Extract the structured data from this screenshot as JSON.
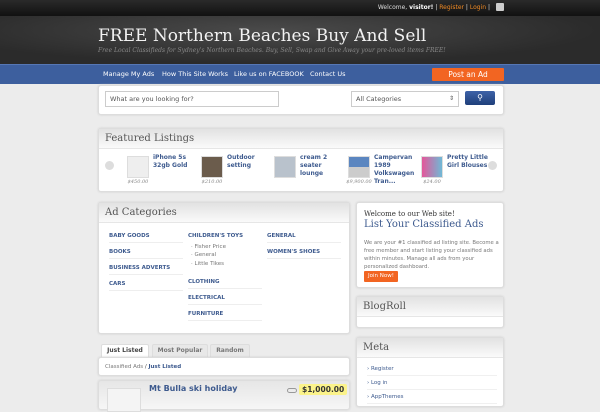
{
  "topbar": {
    "welcome": "Welcome,",
    "user": "visitor!",
    "register": "Register",
    "login": "Login",
    "sep": "|"
  },
  "header": {
    "title": "FREE Northern Beaches Buy And Sell",
    "tagline": "Free Local Classifieds for Sydney's Northern Beaches. Buy, Sell, Swap and Give Away your pre-loved items FREE!"
  },
  "nav": {
    "items": [
      "Manage My Ads",
      "How This Site Works",
      "Like us on FACEBOOK",
      "Contact Us"
    ],
    "post_ad": "Post an Ad"
  },
  "search": {
    "placeholder": "What are you looking for?",
    "category": "All Categories"
  },
  "featured": {
    "title": "Featured Listings",
    "items": [
      {
        "title": "iPhone 5s 32gb Gold",
        "price": "$450.00"
      },
      {
        "title": "Outdoor setting",
        "price": "$210.00"
      },
      {
        "title": "cream 2 seater lounge",
        "price": ""
      },
      {
        "title": "Campervan 1989 Volkswagen Tran...",
        "price": "$9,900.00"
      },
      {
        "title": "Pretty Little Girl Blouses",
        "price": "$24.00"
      }
    ]
  },
  "categories": {
    "title": "Ad Categories",
    "col1": [
      "BABY GOODS",
      "BOOKS",
      "BUSINESS ADVERTS",
      "CARS"
    ],
    "col2_head": "CHILDREN'S TOYS",
    "col2_subs": [
      "Fisher Price",
      "General",
      "Little Tikes"
    ],
    "col2": [
      "CLOTHING",
      "ELECTRICAL",
      "FURNITURE"
    ],
    "col3": [
      "GENERAL",
      "WOMEN'S SHOES"
    ]
  },
  "welcome_box": {
    "heading": "Welcome to our Web site!",
    "title": "List Your Classified Ads",
    "text": "We are your #1 classified ad listing site. Become a free member and start listing your classified ads within minutes. Manage all ads from your personalized dashboard.",
    "button": "Join Now!"
  },
  "blogroll": {
    "title": "BlogRoll"
  },
  "meta": {
    "title": "Meta",
    "items": [
      "Register",
      "Log in",
      "AppThemes"
    ]
  },
  "tabs": [
    "Just Listed",
    "Most Popular",
    "Random"
  ],
  "breadcrumb": {
    "root": "Classified Ads",
    "sep": "/",
    "current": "Just Listed"
  },
  "listing": {
    "title": "Mt Bulla ski holiday",
    "price": "$1,000.00"
  }
}
